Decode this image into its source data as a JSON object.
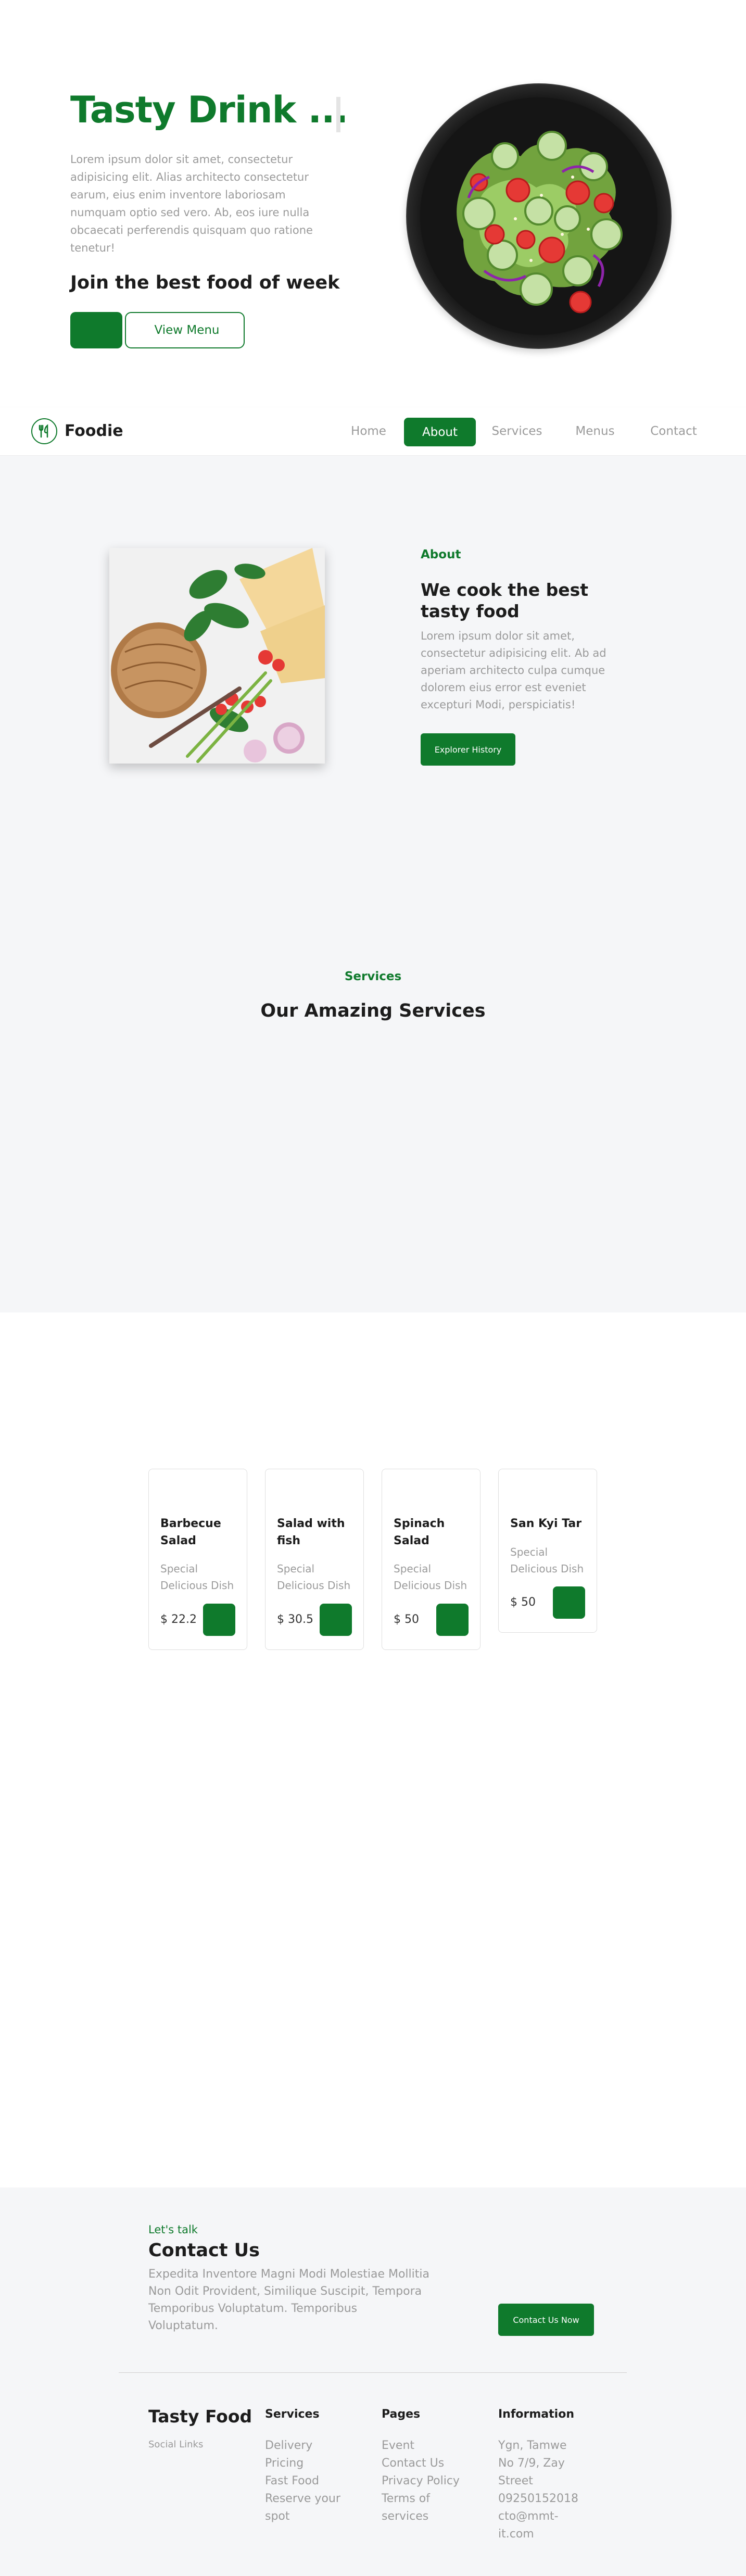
{
  "hero": {
    "title": "Tasty Drink ...",
    "text": "Lorem ipsum dolor sit amet, consectetur adipisicing elit. Alias architecto consectetur earum, eius enim inventore laboriosam numquam optio sed vero. Ab, eos iure nulla obcaecati perferendis quisquam quo ratione tenetur!",
    "subtitle": "Join the best food of week",
    "primary_icon": "",
    "menu_icon": "",
    "menu_label": "View Menu"
  },
  "nav": {
    "brand": "Foodie",
    "items": [
      {
        "label": "Home"
      },
      {
        "label": "About"
      },
      {
        "label": "Services"
      },
      {
        "label": "Menus"
      },
      {
        "label": "Contact"
      }
    ],
    "active": "About"
  },
  "about": {
    "tag": "About",
    "title": "We cook the best tasty food",
    "text": "Lorem ipsum dolor sit amet, consectetur adipisicing elit. Ab ad aperiam architecto culpa cumque dolorem eius error est eveniet excepturi Modi, perspiciatis!",
    "button": "Explorer History"
  },
  "services": {
    "tag": "Services",
    "title": "Our Amazing Services"
  },
  "menu": {
    "cards": [
      {
        "name": "Barbecue Salad",
        "desc": "Special Delicious Dish",
        "price": "$ 22.2",
        "icon": ""
      },
      {
        "name": "Salad with fish",
        "desc": "Special Delicious Dish",
        "price": "$ 30.5",
        "icon": ""
      },
      {
        "name": "Spinach Salad",
        "desc": "Special Delicious Dish",
        "price": "$ 50",
        "icon": ""
      },
      {
        "name": "San Kyi Tar",
        "desc": "Special Delicious Dish",
        "price": "$ 50",
        "icon": ""
      }
    ]
  },
  "contact": {
    "tag": "Let's talk",
    "title": "Contact Us",
    "text": "Expedita Inventore Magni Modi Molestiae Mollitia Non Odit Provident, Similique Suscipit, Tempora Temporibus Voluptatum. Temporibus Voluptatum.",
    "button": "Contact Us Now"
  },
  "footer": {
    "brand": "Tasty Food",
    "social": "Social Links",
    "columns": [
      {
        "title": "Services",
        "links": [
          "Delivery",
          "Pricing",
          "Fast Food",
          "Reserve your spot"
        ]
      },
      {
        "title": "Pages",
        "links": [
          "Event",
          "Contact Us",
          "Privacy Policy",
          "Terms of services"
        ]
      },
      {
        "title": "Information",
        "links": [
          "Ygn, Tamwe",
          "No 7/9, Zay Street",
          "09250152018",
          "cto@mmt-it.com"
        ]
      }
    ]
  },
  "colors": {
    "accent": "#0f7a2c",
    "band": "#f5f6f8",
    "muted_text": "#9a9a9a"
  }
}
